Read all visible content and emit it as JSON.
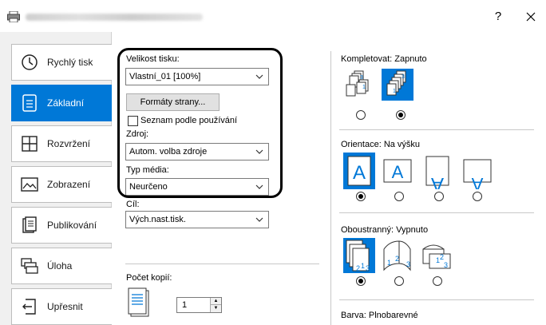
{
  "window": {
    "help_label": "?",
    "close_icon": "close-icon"
  },
  "sidebar": {
    "items": [
      {
        "label": "Rychlý tisk",
        "icon": "clock-icon",
        "active": false
      },
      {
        "label": "Základní",
        "icon": "document-icon",
        "active": true
      },
      {
        "label": "Rozvržení",
        "icon": "layout-grid-icon",
        "active": false
      },
      {
        "label": "Zobrazení",
        "icon": "image-icon",
        "active": false
      },
      {
        "label": "Publikování",
        "icon": "book-icon",
        "active": false
      },
      {
        "label": "Úloha",
        "icon": "stack-icon",
        "active": false
      },
      {
        "label": "Upřesnit",
        "icon": "arrow-left-icon",
        "active": false
      }
    ]
  },
  "basic": {
    "print_size_label": "Velikost tisku:",
    "print_size_value": "Vlastní_01 [100%]",
    "page_formats_button": "Formáty strany...",
    "list_by_usage_label": "Seznam podle používání",
    "source_label": "Zdroj:",
    "source_value": "Autom. volba zdroje",
    "media_type_label": "Typ média:",
    "media_type_value": "Neurčeno",
    "destination_label": "Cíl:",
    "destination_value": "Vých.nast.tisk.",
    "copies_label": "Počet kopií:",
    "copies_value": "1",
    "spin_up": "▲",
    "spin_down": "▼"
  },
  "collate": {
    "label": "Kompletovat:",
    "value": "Zapnuto",
    "selected_index": 1
  },
  "orientation": {
    "label": "Orientace:",
    "value": "Na výšku",
    "letter": "A",
    "selected_index": 0
  },
  "duplex": {
    "label": "Oboustranný:",
    "value": "Vypnuto",
    "selected_index": 0,
    "page_numbers": [
      "1",
      "2",
      "3"
    ]
  },
  "color": {
    "label": "Barva:",
    "value": "Plnobarevné"
  },
  "colors": {
    "accent": "#0078d7",
    "sidebar_bg": "#f0f0f0"
  }
}
